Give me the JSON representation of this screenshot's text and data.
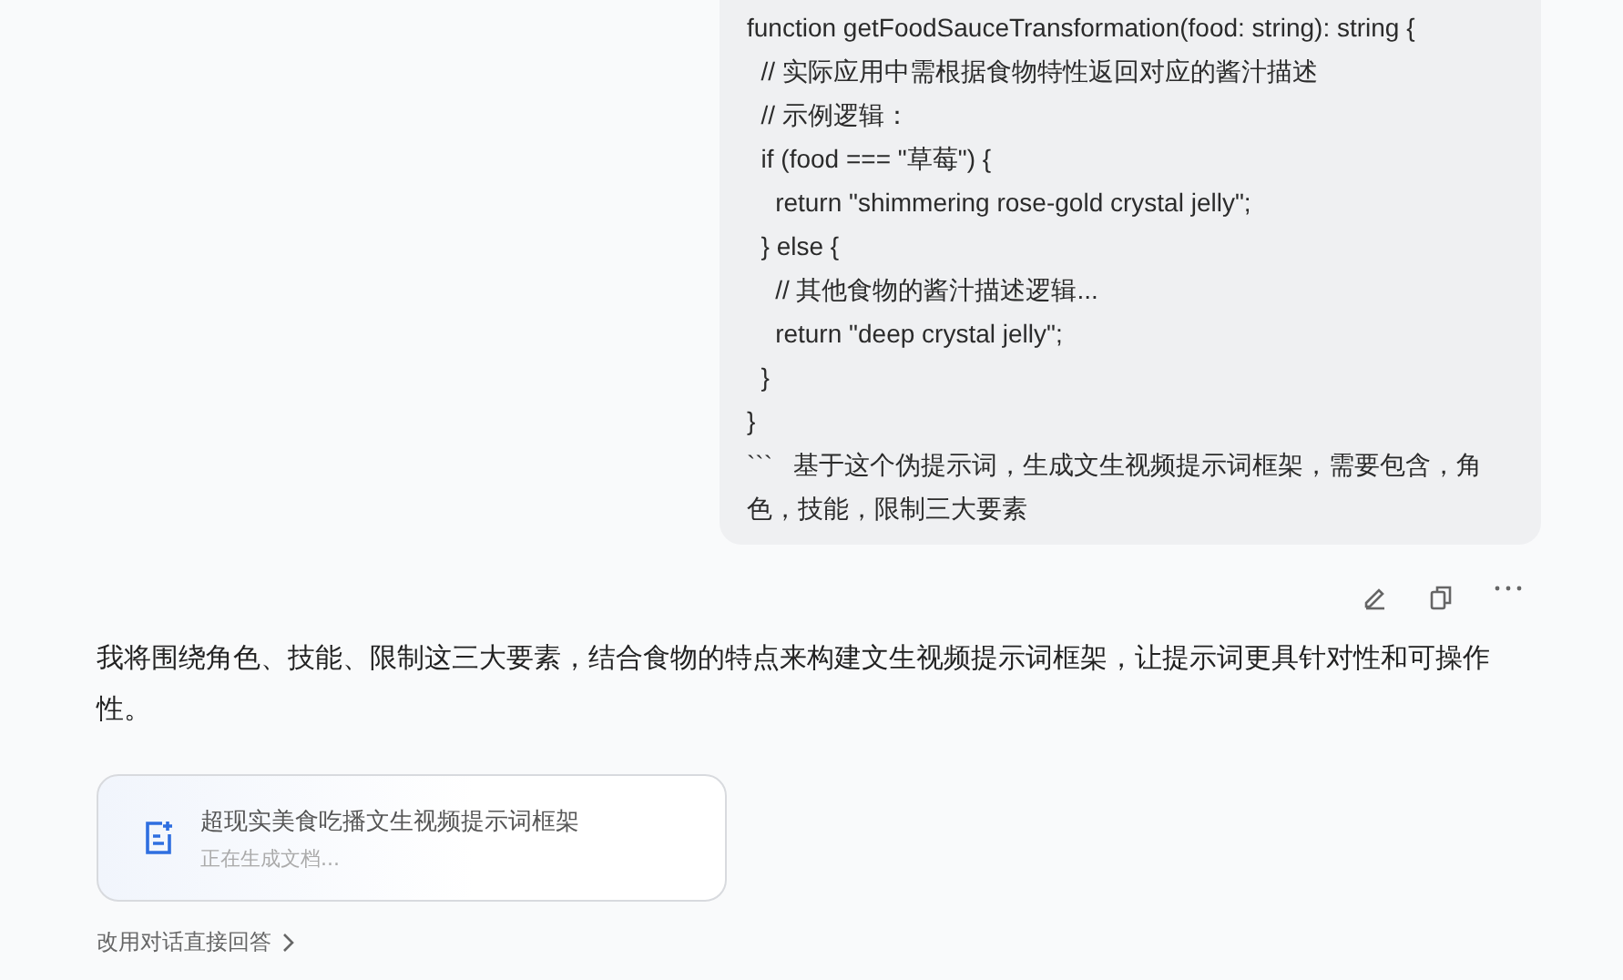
{
  "user_message": {
    "lines": [
      "function getFoodSauceTransformation(food: string): string {",
      "  // 实际应用中需根据食物特性返回对应的酱汁描述",
      "  // 示例逻辑：",
      "  if (food === \"草莓\") {",
      "    return \"shimmering rose-gold crystal jelly\";",
      "  } else {",
      "    // 其他食物的酱汁描述逻辑...",
      "    return \"deep crystal jelly\";",
      "  }",
      "}",
      "```   基于这个伪提示词，生成文生视频提示词框架，需要包含，角色，技能，限制三大要素"
    ],
    "actions": [
      {
        "kind": "edit"
      },
      {
        "kind": "copy"
      },
      {
        "kind": "more"
      }
    ]
  },
  "reply": {
    "text": "我将围绕角色、技能、限制这三大要素，结合食物的特点来构建文生视频提示词框架，让提示词更具针对性和可操作性。",
    "document": {
      "title": "超现实美食吃播文生视频提示词框架",
      "status": "正在生成文档..."
    },
    "switch_link": "改用对话直接回答"
  }
}
